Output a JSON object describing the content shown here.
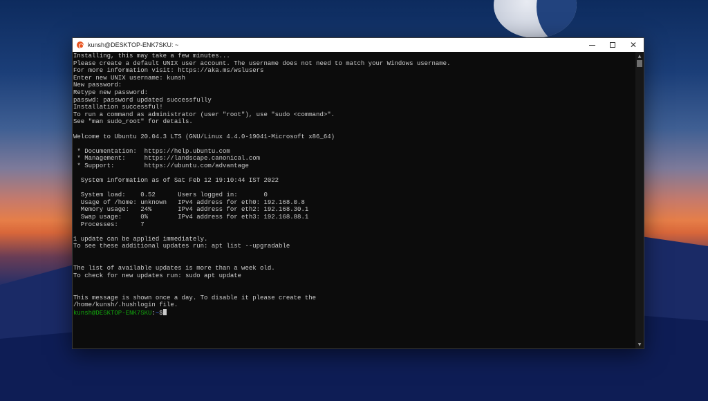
{
  "window": {
    "title": "kunsh@DESKTOP-ENK7SKU: ~",
    "minimize_glyph": "",
    "maximize_glyph": "",
    "close_glyph": "✕"
  },
  "terminal": {
    "lines": [
      "Installing, this may take a few minutes...",
      "Please create a default UNIX user account. The username does not need to match your Windows username.",
      "For more information visit: https://aka.ms/wslusers",
      "Enter new UNIX username: kunsh",
      "New password:",
      "Retype new password:",
      "passwd: password updated successfully",
      "Installation successful!",
      "To run a command as administrator (user \"root\"), use \"sudo <command>\".",
      "See \"man sudo_root\" for details.",
      "",
      "Welcome to Ubuntu 20.04.3 LTS (GNU/Linux 4.4.0-19041-Microsoft x86_64)",
      "",
      " * Documentation:  https://help.ubuntu.com",
      " * Management:     https://landscape.canonical.com",
      " * Support:        https://ubuntu.com/advantage",
      "",
      "  System information as of Sat Feb 12 19:10:44 IST 2022",
      "",
      "  System load:    0.52      Users logged in:       0",
      "  Usage of /home: unknown   IPv4 address for eth0: 192.168.0.8",
      "  Memory usage:   24%       IPv4 address for eth2: 192.168.30.1",
      "  Swap usage:     0%        IPv4 address for eth3: 192.168.88.1",
      "  Processes:      7",
      "",
      "1 update can be applied immediately.",
      "To see these additional updates run: apt list --upgradable",
      "",
      "",
      "The list of available updates is more than a week old.",
      "To check for new updates run: sudo apt update",
      "",
      "",
      "This message is shown once a day. To disable it please create the",
      "/home/kunsh/.hushlogin file."
    ],
    "prompt": {
      "user_host": "kunsh@DESKTOP-ENK7SKU",
      "colon": ":",
      "path": "~",
      "symbol": "$"
    }
  },
  "colors": {
    "terminal_bg": "#0c0c0c",
    "terminal_fg": "#cccccc",
    "prompt_green": "#13a10e",
    "prompt_blue": "#3b78ff",
    "ubuntu_orange": "#e95420"
  },
  "icons": {
    "app": "ubuntu-icon",
    "scroll_up": "scroll-up-arrow-icon",
    "scroll_down": "scroll-down-arrow-icon"
  }
}
